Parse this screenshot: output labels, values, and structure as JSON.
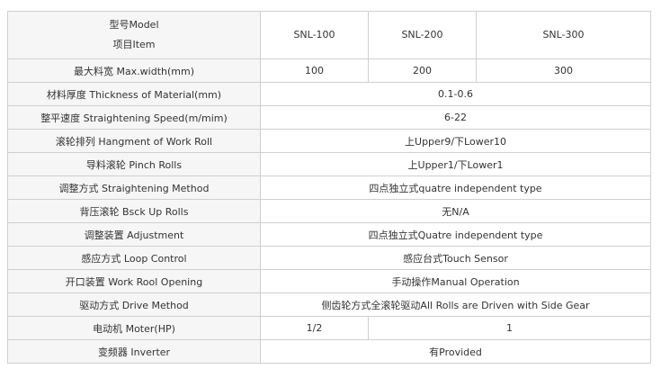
{
  "header": {
    "item_line1": "型号Model",
    "item_line2": "项目Item",
    "models": [
      "SNL-100",
      "SNL-200",
      "SNL-300"
    ]
  },
  "rows": [
    {
      "label": "最大料宽 Max.width(mm)",
      "values": [
        "100",
        "200",
        "300"
      ]
    },
    {
      "label": "材料厚度 Thickness of Material(mm)",
      "value": "0.1-0.6"
    },
    {
      "label": "整平速度 Straightening Speed(m/mim)",
      "value": "6-22"
    },
    {
      "label": "滚轮排列 Hangment of Work Roll",
      "value": "上Upper9/下Lower10"
    },
    {
      "label": "导料滚轮 Pinch Rolls",
      "value": "上Upper1/下Lower1"
    },
    {
      "label": "调整方式 Straightening Method",
      "value": "四点独立式quatre independent type"
    },
    {
      "label": "背压滚轮 Bsck Up Rolls",
      "value": "无N/A"
    },
    {
      "label": "调整装置 Adjustment",
      "value": "四点独立式Quatre independent type"
    },
    {
      "label": "感应方式 Loop Control",
      "value": "感应台式Touch Sensor"
    },
    {
      "label": "开口装置 Work Rool Opening",
      "value": "手动操作Manual Operation"
    },
    {
      "label": "驱动方式 Drive Method",
      "value": "侧齿轮方式全滚轮驱动All Rolls are Driven with Side Gear"
    },
    {
      "label": "电动机 Moter(HP)",
      "values": [
        "1/2",
        "1"
      ]
    },
    {
      "label": "变频器 Inverter",
      "value": "有Provided"
    }
  ]
}
